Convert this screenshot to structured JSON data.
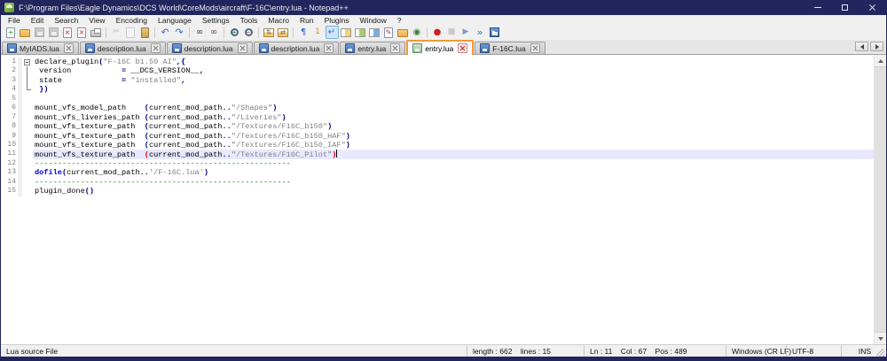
{
  "window": {
    "title": "F:\\Program Files\\Eagle Dynamics\\DCS World\\CoreMods\\aircraft\\F-16C\\entry.lua - Notepad++"
  },
  "colors": {
    "titlebar": "#23255e",
    "active_tab_accent": "#ef9b38",
    "string_gray": "#808080",
    "operator_navy": "#000080",
    "keyword_blue": "#0000e0",
    "comment_green": "#008000",
    "brace_match_red": "#e00000",
    "current_line_bg": "#e8e8ff"
  },
  "menu": {
    "items": [
      "File",
      "Edit",
      "Search",
      "View",
      "Encoding",
      "Language",
      "Settings",
      "Tools",
      "Macro",
      "Run",
      "Plugins",
      "Window",
      "?"
    ]
  },
  "toolbar": {
    "buttons": [
      {
        "name": "new-file",
        "shape": "page",
        "glyph": "+",
        "gcolor": "#2aa02a",
        "gsize": 8
      },
      {
        "name": "open-file",
        "shape": "folder"
      },
      {
        "name": "save-file",
        "shape": "floppy",
        "state": "disabled"
      },
      {
        "name": "save-all",
        "shape": "floppy",
        "state": "disabled"
      },
      {
        "name": "close-file",
        "shape": "page",
        "glyph": "×",
        "gcolor": "#c03030",
        "gsize": 8
      },
      {
        "name": "close-all",
        "shape": "page",
        "glyph": "×",
        "gcolor": "#c03030",
        "gsize": 8
      },
      {
        "name": "print",
        "shape": "printer"
      },
      {
        "name": "cut",
        "glyph": "✂",
        "gcolor": "#556070",
        "state": "disabled",
        "sep": true
      },
      {
        "name": "copy",
        "shape": "page",
        "state": "disabled"
      },
      {
        "name": "paste",
        "shape": "clip"
      },
      {
        "name": "undo",
        "glyph": "↶",
        "gcolor": "#3a6ad0",
        "gsize": 11,
        "sep": true
      },
      {
        "name": "redo",
        "glyph": "↷",
        "gcolor": "#3a6ad0",
        "gsize": 11
      },
      {
        "name": "find",
        "glyph": "∞",
        "gcolor": "#333a44",
        "gsize": 10,
        "sep": true
      },
      {
        "name": "replace",
        "glyph": "∞",
        "gcolor": "#7a4a2a",
        "gsize": 10
      },
      {
        "name": "zoom-in",
        "shape": "mag",
        "glyph": "+",
        "gcolor": "#2a7a2a",
        "gsize": 7,
        "sep": true
      },
      {
        "name": "zoom-out",
        "shape": "mag",
        "glyph": "−",
        "gcolor": "#c03030",
        "gsize": 7
      },
      {
        "name": "sync-vertical-scroll",
        "shape": "win",
        "glyph": "⇅",
        "gcolor": "#406080",
        "gsize": 7,
        "sep": true
      },
      {
        "name": "sync-horizontal-scroll",
        "shape": "win",
        "glyph": "⇄",
        "gcolor": "#406080",
        "gsize": 7
      },
      {
        "name": "show-all-characters",
        "glyph": "¶",
        "gcolor": "#3a6ad0",
        "gsize": 10,
        "sep": true
      },
      {
        "name": "show-indent-guide",
        "glyph": "1",
        "gcolor": "#e08020",
        "gsize": 9
      },
      {
        "name": "word-wrap",
        "glyph": "↵",
        "gcolor": "#3a6ad0",
        "gsize": 10,
        "state": "active"
      },
      {
        "name": "function-list",
        "shape": "panel-y"
      },
      {
        "name": "document-map",
        "shape": "panel-g"
      },
      {
        "name": "document-list",
        "shape": "panel-b"
      },
      {
        "name": "edit-popup",
        "shape": "page",
        "glyph": "✎",
        "gcolor": "#c03030",
        "gsize": 8
      },
      {
        "name": "folder-as-workspace",
        "shape": "folder"
      },
      {
        "name": "file-monitoring",
        "glyph": "◉",
        "gcolor": "#3a7a3a",
        "gsize": 10
      },
      {
        "name": "macro-record",
        "glyph": "●",
        "gcolor": "#d02020",
        "gsize": 10,
        "sep": true
      },
      {
        "name": "macro-stop",
        "glyph": "■",
        "gcolor": "#888888",
        "gsize": 9,
        "state": "disabled"
      },
      {
        "name": "macro-play",
        "glyph": "▶",
        "gcolor": "#7a9ac0",
        "gsize": 9
      },
      {
        "name": "macro-run-multiple",
        "glyph": "»",
        "gcolor": "#2a7ab0",
        "gsize": 11
      },
      {
        "name": "macro-save",
        "shape": "floppy",
        "glyph": "▶",
        "gcolor": "#ffffff",
        "gsize": 6
      }
    ]
  },
  "tabs": [
    {
      "label": "MyIADS.lua",
      "active": false
    },
    {
      "label": "description.lua",
      "active": false
    },
    {
      "label": "description.lua",
      "active": false
    },
    {
      "label": "description.lua",
      "active": false
    },
    {
      "label": "entry.lua",
      "active": false
    },
    {
      "label": "entry.lua",
      "active": true
    },
    {
      "label": "F-16C.lua",
      "active": false
    }
  ],
  "editor": {
    "current_line": 11,
    "lines": [
      {
        "num": 1,
        "fold": "open",
        "seg": [
          [
            "declare_plugin",
            "id"
          ],
          [
            "(",
            "op"
          ],
          [
            "\"F-16C b1.50 AI\"",
            "str"
          ],
          [
            ",",
            "op"
          ],
          [
            "{",
            "op"
          ]
        ]
      },
      {
        "num": 2,
        "fold": "cont",
        "seg": [
          [
            " version           ",
            "id"
          ],
          [
            "= ",
            "op"
          ],
          [
            "__DCS_VERSION__",
            "id"
          ],
          [
            ",",
            "op"
          ]
        ]
      },
      {
        "num": 3,
        "fold": "cont",
        "seg": [
          [
            " state             ",
            "id"
          ],
          [
            "= ",
            "op"
          ],
          [
            "\"installed\"",
            "str"
          ],
          [
            ",",
            "op"
          ]
        ]
      },
      {
        "num": 4,
        "fold": "end",
        "seg": [
          [
            " ",
            "id"
          ],
          [
            "})",
            "op"
          ]
        ]
      },
      {
        "num": 5,
        "seg": []
      },
      {
        "num": 6,
        "seg": [
          [
            "mount_vfs_model_path    ",
            "id"
          ],
          [
            "(",
            "op"
          ],
          [
            "current_mod_path",
            "id"
          ],
          [
            "..",
            "op"
          ],
          [
            "\"/Shapes\"",
            "str"
          ],
          [
            ")",
            "op"
          ]
        ]
      },
      {
        "num": 7,
        "seg": [
          [
            "mount_vfs_liveries_path ",
            "id"
          ],
          [
            "(",
            "op"
          ],
          [
            "current_mod_path",
            "id"
          ],
          [
            "..",
            "op"
          ],
          [
            "\"/Liveries\"",
            "str"
          ],
          [
            ")",
            "op"
          ]
        ]
      },
      {
        "num": 8,
        "seg": [
          [
            "mount_vfs_texture_path  ",
            "id"
          ],
          [
            "(",
            "op"
          ],
          [
            "current_mod_path",
            "id"
          ],
          [
            "..",
            "op"
          ],
          [
            "\"/Textures/F16C_b150\"",
            "str"
          ],
          [
            ")",
            "op"
          ]
        ]
      },
      {
        "num": 9,
        "seg": [
          [
            "mount_vfs_texture_path  ",
            "id"
          ],
          [
            "(",
            "op"
          ],
          [
            "current_mod_path",
            "id"
          ],
          [
            "..",
            "op"
          ],
          [
            "\"/Textures/F16C_b150_HAF\"",
            "str"
          ],
          [
            ")",
            "op"
          ]
        ]
      },
      {
        "num": 10,
        "seg": [
          [
            "mount_vfs_texture_path  ",
            "id"
          ],
          [
            "(",
            "op"
          ],
          [
            "current_mod_path",
            "id"
          ],
          [
            "..",
            "op"
          ],
          [
            "\"/Textures/F16C_b150_IAF\"",
            "str"
          ],
          [
            ")",
            "op"
          ]
        ]
      },
      {
        "num": 11,
        "current": true,
        "caret": true,
        "seg": [
          [
            "mount_vfs_texture_path  ",
            "id"
          ],
          [
            "(",
            "match"
          ],
          [
            "current_mod_path",
            "id"
          ],
          [
            "..",
            "op"
          ],
          [
            "\"/Textures/F16C_Pilot\"",
            "str"
          ],
          [
            ")",
            "match"
          ]
        ]
      },
      {
        "num": 12,
        "seg": [
          [
            "--------------------------------------------------------",
            "com"
          ]
        ]
      },
      {
        "num": 13,
        "seg": [
          [
            "dofile",
            "kw"
          ],
          [
            "(",
            "op"
          ],
          [
            "current_mod_path",
            "id"
          ],
          [
            "..",
            "op"
          ],
          [
            "'/F-16C.lua'",
            "str"
          ],
          [
            ")",
            "op"
          ]
        ]
      },
      {
        "num": 14,
        "seg": [
          [
            "--------------------------------------------------------",
            "com"
          ]
        ]
      },
      {
        "num": 15,
        "seg": [
          [
            "plugin_done",
            "id"
          ],
          [
            "()",
            "op"
          ]
        ]
      }
    ]
  },
  "statusbar": {
    "doc_type": "Lua source File",
    "length_info": "length : 662    lines : 15",
    "cursor_info": "Ln : 11    Col : 67    Pos : 489",
    "eol": "Windows (CR LF)",
    "encoding": "UTF-8",
    "insert_mode": "INS"
  }
}
